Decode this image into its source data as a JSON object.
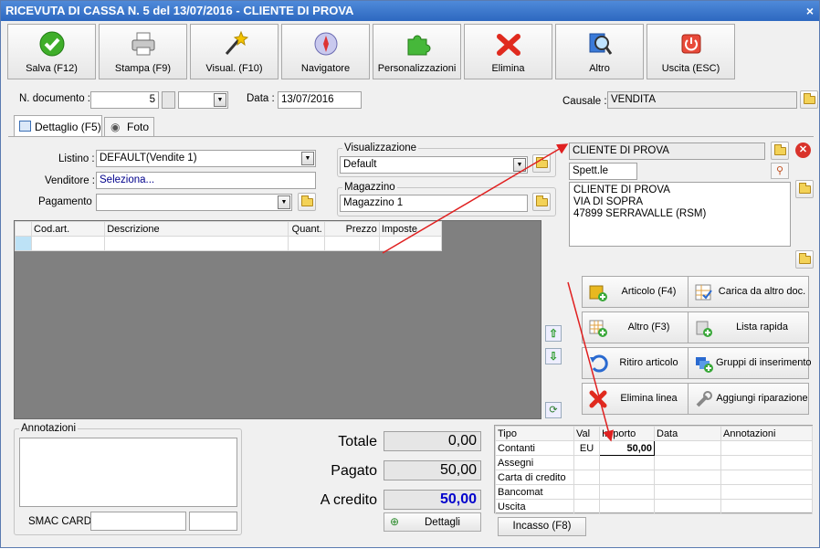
{
  "window": {
    "title": "RICEVUTA DI CASSA N. 5 del 13/07/2016 - CLIENTE DI PROVA",
    "close": "×"
  },
  "toolbar": [
    {
      "label": "Salva (F12)",
      "icon": "check-icon"
    },
    {
      "label": "Stampa (F9)",
      "icon": "printer-icon"
    },
    {
      "label": "Visual. (F10)",
      "icon": "magic-wand-icon"
    },
    {
      "label": "Navigatore",
      "icon": "compass-icon"
    },
    {
      "label": "Personalizzazioni",
      "icon": "puzzle-icon"
    },
    {
      "label": "Elimina",
      "icon": "delete-icon"
    },
    {
      "label": "Altro",
      "icon": "magnifier-icon"
    },
    {
      "label": "Uscita (ESC)",
      "icon": "power-icon"
    }
  ],
  "header": {
    "doc_label": "N. documento :",
    "doc_value": "5",
    "date_label": "Data :",
    "date_value": "13/07/2016",
    "causale_label": "Causale :",
    "causale_value": "VENDITA"
  },
  "tabs": [
    "Dettaglio (F5)",
    "Foto"
  ],
  "form": {
    "listino_label": "Listino :",
    "listino_value": "DEFAULT(Vendite 1)",
    "venditore_label": "Venditore :",
    "venditore_value": "Seleziona...",
    "pagamento_label": "Pagamento :",
    "pagamento_value": "",
    "vis_label": "Visualizzazione",
    "vis_value": "Default",
    "mag_label": "Magazzino",
    "mag_value": "Magazzino 1"
  },
  "customer": {
    "name": "CLIENTE DI PROVA",
    "title": "Spett.le",
    "address_lines": [
      "CLIENTE DI PROVA",
      "VIA DI SOPRA",
      "47899 SERRAVALLE (RSM)"
    ]
  },
  "lines_table": {
    "headers": [
      "Cod.art.",
      "Descrizione",
      "Quant.",
      "Prezzo",
      "Imposte"
    ]
  },
  "actions": [
    "Articolo (F4)",
    "Carica da altro doc.",
    "Altro (F3)",
    "Lista rapida",
    "Ritiro articolo",
    "Gruppi di inserimento",
    "Elimina linea",
    "Aggiungi riparazione"
  ],
  "notes": {
    "label": "Annotazioni",
    "smac_label": "SMAC CARD"
  },
  "totals": {
    "totale_label": "Totale",
    "totale_value": "0,00",
    "pagato_label": "Pagato",
    "pagato_value": "50,00",
    "credito_label": "A credito",
    "credito_value": "50,00",
    "details_button": "Dettagli"
  },
  "payments": {
    "headers": [
      "Tipo",
      "Val",
      "Importo",
      "Data",
      "Annotazioni"
    ],
    "rows": [
      [
        "Contanti",
        "EU",
        "50,00",
        "",
        ""
      ],
      [
        "Assegni",
        "",
        "",
        "",
        ""
      ],
      [
        "Carta di credito",
        "",
        "",
        "",
        ""
      ],
      [
        "Bancomat",
        "",
        "",
        "",
        ""
      ],
      [
        "Uscita",
        "",
        "",
        "",
        ""
      ]
    ]
  },
  "incasso_button": "Incasso (F8)",
  "colors": {
    "title_bar": "#2d68c0",
    "accent_blue": "#0000cc",
    "arrow_red": "#e02020",
    "grid_dark": "#808080"
  }
}
